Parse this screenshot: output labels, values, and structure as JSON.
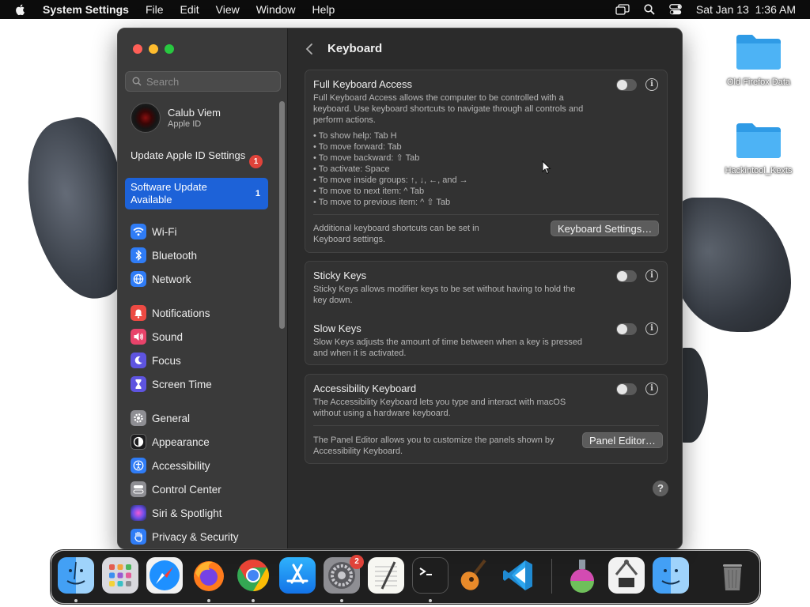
{
  "menubar": {
    "app_name": "System Settings",
    "menus": [
      "File",
      "Edit",
      "View",
      "Window",
      "Help"
    ],
    "datetime": "Sat Jan 13  1:36 AM"
  },
  "desktop": {
    "icons": [
      {
        "label": "Old Firefox Data"
      },
      {
        "label": "Hackintool_Kexts"
      }
    ]
  },
  "sidebar": {
    "search_placeholder": "Search",
    "account": {
      "name": "Calub Viem",
      "sub": "Apple ID"
    },
    "update_apple_id": {
      "label": "Update Apple ID Settings",
      "badge": "1"
    },
    "software_update": {
      "label": "Software Update Available",
      "count": "1"
    },
    "items": [
      {
        "label": "Wi-Fi",
        "icon": "wifi-icon"
      },
      {
        "label": "Bluetooth",
        "icon": "bluetooth-icon"
      },
      {
        "label": "Network",
        "icon": "globe-icon"
      },
      {
        "label": "Notifications",
        "icon": "bell-icon"
      },
      {
        "label": "Sound",
        "icon": "speaker-icon"
      },
      {
        "label": "Focus",
        "icon": "moon-icon"
      },
      {
        "label": "Screen Time",
        "icon": "hourglass-icon"
      },
      {
        "label": "General",
        "icon": "gear-icon"
      },
      {
        "label": "Appearance",
        "icon": "appearance-icon"
      },
      {
        "label": "Accessibility",
        "icon": "accessibility-icon"
      },
      {
        "label": "Control Center",
        "icon": "control-center-icon"
      },
      {
        "label": "Siri & Spotlight",
        "icon": "siri-icon"
      },
      {
        "label": "Privacy & Security",
        "icon": "hand-icon"
      }
    ]
  },
  "content": {
    "title": "Keyboard",
    "full_keyboard_access": {
      "title": "Full Keyboard Access",
      "desc1": "Full Keyboard Access allows the computer to be controlled with a",
      "desc2": "keyboard. Use keyboard shortcuts to navigate through all controls and",
      "desc3": "perform actions.",
      "shortcuts": [
        "• To show help: Tab H",
        "• To move forward: Tab",
        "• To move backward: ⇧ Tab",
        "• To activate: Space",
        "• To move inside groups: ↑, ↓, ←, and →",
        "• To move to next item: ^ Tab",
        "• To move to previous item: ^ ⇧ Tab"
      ],
      "additional1": "Additional keyboard shortcuts can be set in",
      "additional2": "Keyboard settings.",
      "button": "Keyboard Settings…",
      "toggle_on": false
    },
    "sticky_keys": {
      "title": "Sticky Keys",
      "desc1": "Sticky Keys allows modifier keys to be set without having to hold the",
      "desc2": "key down.",
      "toggle_on": false
    },
    "slow_keys": {
      "title": "Slow Keys",
      "desc1": "Slow Keys adjusts the amount of time between when a key is pressed",
      "desc2": "and when it is activated.",
      "toggle_on": false
    },
    "accessibility_keyboard": {
      "title": "Accessibility Keyboard",
      "desc1": "The Accessibility Keyboard lets you type and interact with macOS",
      "desc2": "without using a hardware keyboard.",
      "panel1": "The Panel Editor allows you to customize the panels shown by",
      "panel2": "Accessibility Keyboard.",
      "button": "Panel Editor…",
      "toggle_on": false
    },
    "help_label": "?"
  },
  "dock": {
    "apps": [
      {
        "name": "Finder",
        "icon": "finder-icon"
      },
      {
        "name": "Launchpad",
        "icon": "launchpad-icon"
      },
      {
        "name": "Safari",
        "icon": "safari-icon"
      },
      {
        "name": "Firefox",
        "icon": "firefox-icon"
      },
      {
        "name": "Chrome",
        "icon": "chrome-icon"
      },
      {
        "name": "App Store",
        "icon": "app-store-icon"
      },
      {
        "name": "System Settings",
        "icon": "system-settings-icon",
        "badge": "2"
      },
      {
        "name": "TextEdit",
        "icon": "textedit-icon"
      },
      {
        "name": "Terminal",
        "icon": "terminal-icon"
      },
      {
        "name": "GarageBand",
        "icon": "guitar-icon"
      },
      {
        "name": "Visual Studio Code",
        "icon": "vscode-icon"
      },
      {
        "name": "Flask App",
        "icon": "flask-icon"
      },
      {
        "name": "Hackintool",
        "icon": "hackintool-icon"
      },
      {
        "name": "Migration Assistant",
        "icon": "migration-icon"
      },
      {
        "name": "Trash",
        "icon": "trash-icon"
      }
    ]
  }
}
